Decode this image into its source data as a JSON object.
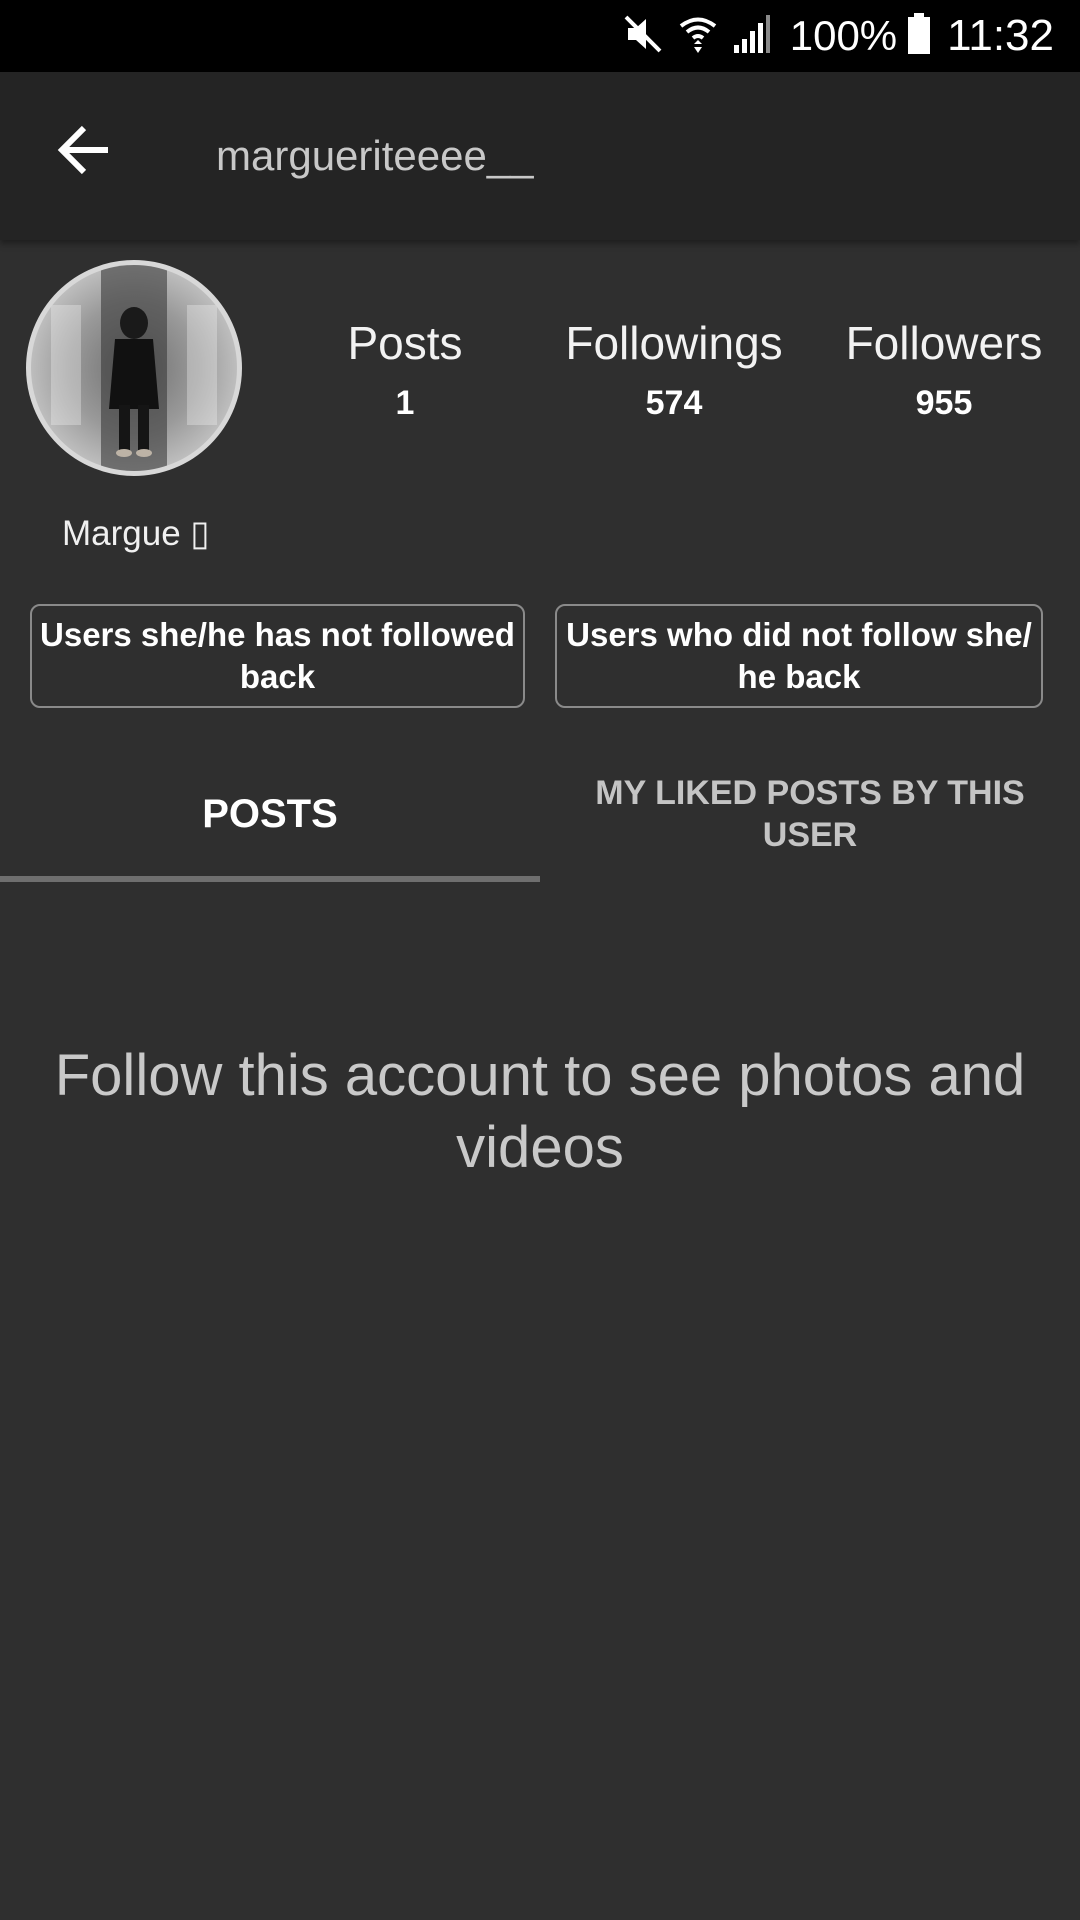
{
  "status_bar": {
    "icons": [
      "mute-icon",
      "wifi-icon",
      "signal-icon",
      "battery-icon"
    ],
    "battery": "100%",
    "time": "11:32"
  },
  "app_bar": {
    "back_icon": "arrow-left-icon",
    "title": "margueriteeee__"
  },
  "profile": {
    "display_name": "Margue ▯",
    "stats": [
      {
        "label": "Posts",
        "value": "1"
      },
      {
        "label": "Followings",
        "value": "574"
      },
      {
        "label": "Followers",
        "value": "955"
      }
    ]
  },
  "actions": {
    "not_followed_back": "Users she/he has not followed back",
    "did_not_follow_back": "Users who did not follow she/ he back"
  },
  "tabs": [
    {
      "label": "POSTS",
      "selected": true
    },
    {
      "label": "MY LIKED POSTS BY THIS USER",
      "selected": false
    }
  ],
  "empty_state": {
    "message": "Follow this account to see photos and videos"
  },
  "colors": {
    "background": "#2f2f2f",
    "app_bar": "#242424",
    "status_bar": "#000000",
    "text_primary": "#ffffff",
    "text_secondary": "#c8c8c8"
  }
}
